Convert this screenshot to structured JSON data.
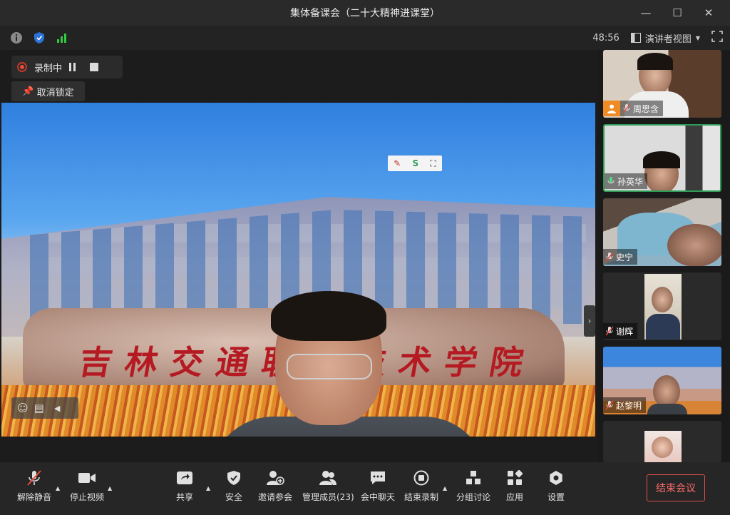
{
  "window": {
    "title": "集体备课会（二十大精神进课堂）",
    "minimize": "—",
    "maximize": "☐",
    "close": "✕"
  },
  "infobar": {
    "timer": "48:56",
    "view_mode": "演讲者视图"
  },
  "recording": {
    "label": "录制中"
  },
  "unlock": {
    "label": "取消锁定"
  },
  "video": {
    "sign_text": "吉林交通职业技术学院"
  },
  "participants": [
    {
      "name": "周思含"
    },
    {
      "name": "孙英华"
    },
    {
      "name": "史宁"
    },
    {
      "name": "谢辉"
    },
    {
      "name": "赵黎明"
    },
    {
      "name": ""
    }
  ],
  "toolbar": {
    "unmute": "解除静音",
    "stop_video": "停止视频",
    "share": "共享",
    "security": "安全",
    "invite": "邀请参会",
    "manage": "管理成员(23)",
    "chat": "会中聊天",
    "end_record": "结束录制",
    "breakout": "分组讨论",
    "apps": "应用",
    "settings": "设置",
    "end_meeting": "结束会议"
  },
  "colors": {
    "accent_green": "#2e9c56",
    "end_red": "#e05050",
    "record_red": "#e74c3c"
  }
}
